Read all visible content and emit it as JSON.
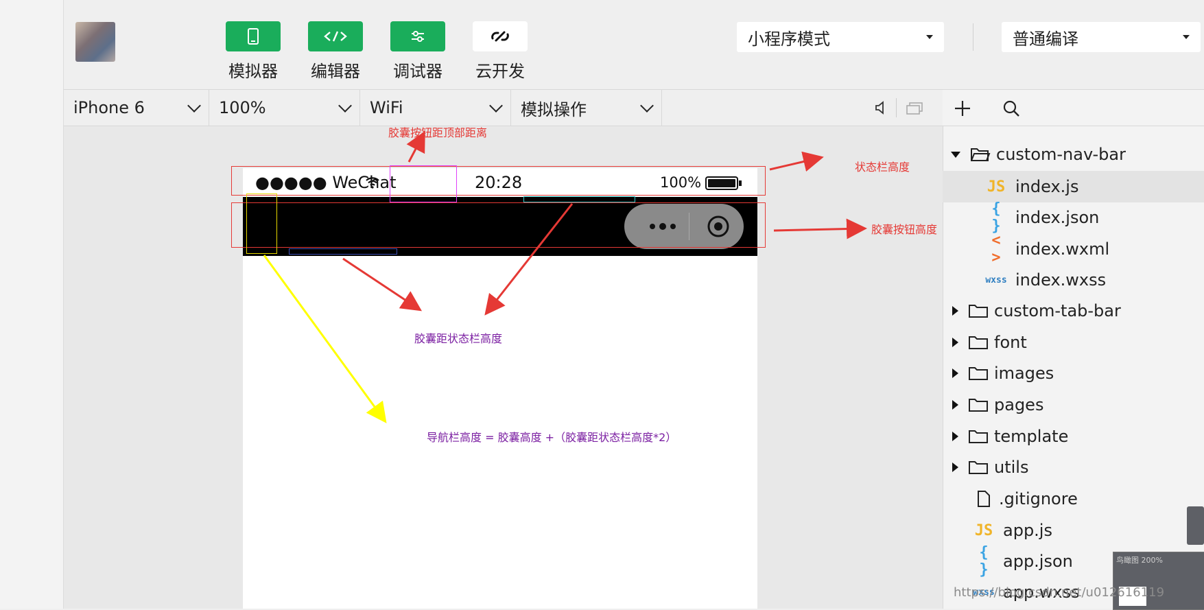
{
  "toolbar": {
    "simulator_label": "模拟器",
    "editor_label": "编辑器",
    "debugger_label": "调试器",
    "cloud_label": "云开发",
    "mode_select": "小程序模式",
    "compile_select": "普通编译"
  },
  "device_bar": {
    "device": "iPhone 6",
    "zoom": "100%",
    "network": "WiFi",
    "simulate": "模拟操作"
  },
  "phone": {
    "signal": "●●●●● WeChat",
    "time": "20:28",
    "battery": "100%"
  },
  "annotations": {
    "capsule_top_distance": "胶囊按钮距顶部距离",
    "status_bar_height": "状态栏高度",
    "capsule_height": "胶囊按钮高度",
    "capsule_to_status": "胶囊距状态栏高度",
    "nav_formula": "导航栏高度 = 胶囊高度 +（胶囊距状态栏高度*2）"
  },
  "file_tree": [
    {
      "name": "custom-nav-bar",
      "type": "folder-open",
      "icon": "folder-open-icon"
    },
    {
      "name": "index.js",
      "type": "js",
      "icon": "JS",
      "selected": true
    },
    {
      "name": "index.json",
      "type": "json",
      "icon": "{ }"
    },
    {
      "name": "index.wxml",
      "type": "wxml",
      "icon": "< >"
    },
    {
      "name": "index.wxss",
      "type": "wxss",
      "icon": "wxss"
    },
    {
      "name": "custom-tab-bar",
      "type": "folder"
    },
    {
      "name": "font",
      "type": "folder"
    },
    {
      "name": "images",
      "type": "folder"
    },
    {
      "name": "pages",
      "type": "folder"
    },
    {
      "name": "template",
      "type": "folder"
    },
    {
      "name": "utils",
      "type": "folder"
    },
    {
      "name": ".gitignore",
      "type": "file"
    },
    {
      "name": "app.js",
      "type": "js",
      "icon": "JS"
    },
    {
      "name": "app.json",
      "type": "json",
      "icon": "{ }"
    },
    {
      "name": "app.wxss",
      "type": "wxss",
      "icon": "wxss"
    }
  ],
  "thumbnail_label": "鸟瞰图 200%",
  "watermark": "https://blog.csdn.net/u012616119",
  "colors": {
    "accent_green": "#1aad5b",
    "annotation_red": "#e53935",
    "annotation_purple": "#7b1fa2",
    "annotation_yellow": "#ffff00"
  }
}
